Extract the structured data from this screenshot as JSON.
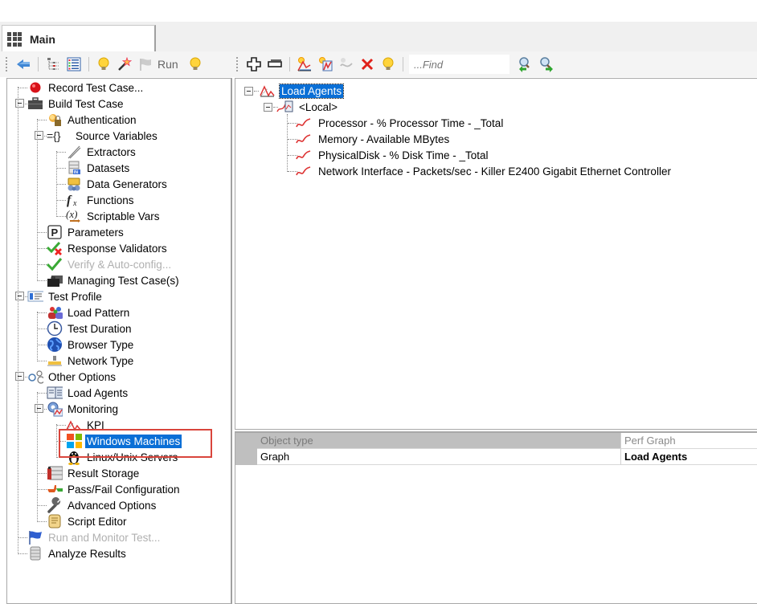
{
  "tabs": [
    {
      "label": "Main",
      "active": true
    }
  ],
  "left_toolbar": {
    "items": [
      {
        "icon": "back-arrow-icon"
      },
      {
        "icon": "tree-view-icon"
      },
      {
        "icon": "list-view-icon"
      },
      {
        "icon": "lightbulb-icon"
      },
      {
        "icon": "magic-wand-icon"
      },
      {
        "icon": "flag-icon",
        "label": "Run",
        "disabled": true
      },
      {
        "icon": "lightbulb-icon"
      }
    ],
    "run_label": "Run"
  },
  "right_toolbar": {
    "find_placeholder": "...Find",
    "items": [
      {
        "icon": "expand-all-icon"
      },
      {
        "icon": "collapse-all-icon"
      },
      {
        "icon": "add-graph-icon"
      },
      {
        "icon": "add-counter-icon"
      },
      {
        "icon": "counter-disabled-icon"
      },
      {
        "icon": "delete-icon"
      },
      {
        "icon": "lightbulb-icon"
      },
      {
        "icon": "find-previous-icon"
      },
      {
        "icon": "find-next-icon"
      }
    ]
  },
  "nav_tree": [
    {
      "label": "Record Test Case...",
      "icon": "record-icon"
    },
    {
      "label": "Build Test Case",
      "icon": "briefcase-icon"
    },
    {
      "label": "Authentication",
      "icon": "authentication-icon"
    },
    {
      "label": "Source Variables",
      "icon": "braces-icon"
    },
    {
      "label": "Extractors",
      "icon": "extractor-icon"
    },
    {
      "label": "Datasets",
      "icon": "dataset-icon"
    },
    {
      "label": "Data Generators",
      "icon": "data-generator-icon"
    },
    {
      "label": "Functions",
      "icon": "function-icon"
    },
    {
      "label": "Scriptable Vars",
      "icon": "scriptable-var-icon"
    },
    {
      "label": "Parameters",
      "icon": "parameter-icon"
    },
    {
      "label": "Response Validators",
      "icon": "validator-icon"
    },
    {
      "label": "Verify & Auto-config...",
      "icon": "checkmark-icon",
      "disabled": true
    },
    {
      "label": "Managing Test Case(s)",
      "icon": "briefcases-icon"
    },
    {
      "label": "Test Profile",
      "icon": "profile-icon"
    },
    {
      "label": "Load Pattern",
      "icon": "users-icon"
    },
    {
      "label": "Test Duration",
      "icon": "clock-icon"
    },
    {
      "label": "Browser Type",
      "icon": "globe-icon"
    },
    {
      "label": "Network Type",
      "icon": "network-icon"
    },
    {
      "label": "Other Options",
      "icon": "options-icon"
    },
    {
      "label": "Load Agents",
      "icon": "load-agents-icon"
    },
    {
      "label": "Monitoring",
      "icon": "monitoring-icon"
    },
    {
      "label": "KPI",
      "icon": "kpi-icon"
    },
    {
      "label": "Windows Machines",
      "icon": "windows-icon",
      "selected": true
    },
    {
      "label": "Linux/Unix Servers",
      "icon": "linux-icon"
    },
    {
      "label": "Result Storage",
      "icon": "storage-icon"
    },
    {
      "label": "Pass/Fail Configuration",
      "icon": "thumbs-icon"
    },
    {
      "label": "Advanced Options",
      "icon": "wrench-icon"
    },
    {
      "label": "Script Editor",
      "icon": "script-icon"
    },
    {
      "label": "Run and Monitor Test...",
      "icon": "run-flag-icon",
      "disabled": true
    },
    {
      "label": "Analyze Results",
      "icon": "database-icon"
    }
  ],
  "counter_tree": {
    "root": "Load Agents",
    "machine": "<Local>",
    "counters": [
      "Processor - % Processor Time - _Total",
      "Memory - Available MBytes",
      "PhysicalDisk - % Disk Time - _Total",
      "Network Interface - Packets/sec - Killer E2400 Gigabit Ethernet Controller"
    ]
  },
  "properties": {
    "header": {
      "name": "Object type",
      "value": "Perf Graph"
    },
    "rows": [
      {
        "name": "Graph",
        "value": "Load Agents"
      }
    ]
  },
  "colors": {
    "selection": "#0a6fd6",
    "highlight_box": "#d9453c"
  }
}
